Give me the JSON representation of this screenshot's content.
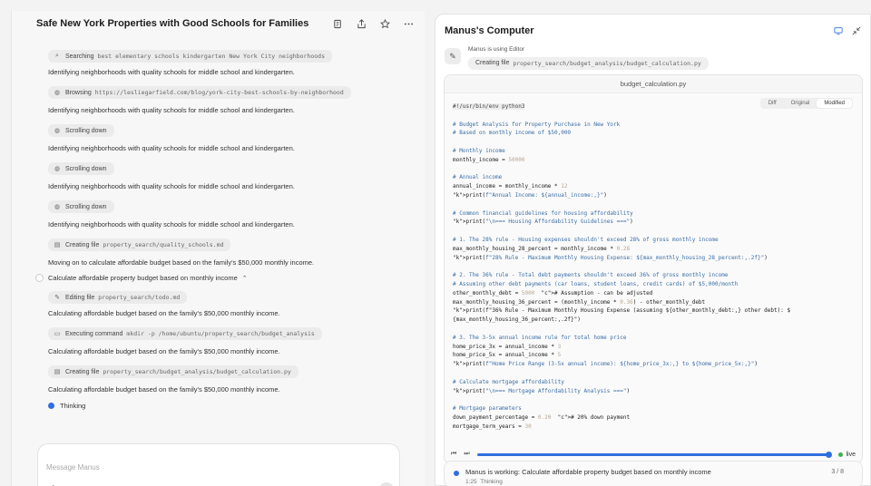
{
  "chat": {
    "title": "Safe New York Properties with Good Schools for Families",
    "composer_placeholder": "Message Manus",
    "steps": [
      {
        "kind": "step",
        "icon": "search-icon",
        "verb": "Searching",
        "arg": "best elementary schools kindergarten New York City neighborhoods"
      },
      {
        "kind": "msg",
        "text": "Identifying neighborhoods with quality schools for middle school and kindergarten."
      },
      {
        "kind": "step",
        "icon": "globe-icon",
        "verb": "Browsing",
        "arg": "https://lesliegarfield.com/blog/york-city-best-schools-by-neighborhood"
      },
      {
        "kind": "msg",
        "text": "Identifying neighborhoods with quality schools for middle school and kindergarten."
      },
      {
        "kind": "step",
        "icon": "globe-icon",
        "verb": "Scrolling down",
        "arg": ""
      },
      {
        "kind": "msg",
        "text": "Identifying neighborhoods with quality schools for middle school and kindergarten."
      },
      {
        "kind": "step",
        "icon": "globe-icon",
        "verb": "Scrolling down",
        "arg": ""
      },
      {
        "kind": "msg",
        "text": "Identifying neighborhoods with quality schools for middle school and kindergarten."
      },
      {
        "kind": "step",
        "icon": "globe-icon",
        "verb": "Scrolling down",
        "arg": ""
      },
      {
        "kind": "msg",
        "text": "Identifying neighborhoods with quality schools for middle school and kindergarten."
      },
      {
        "kind": "step",
        "icon": "file-icon",
        "verb": "Creating file",
        "arg": "property_search/quality_schools.md"
      },
      {
        "kind": "msg",
        "text": "Moving on to calculate affordable budget based on the family's $50,000 monthly income."
      },
      {
        "kind": "task",
        "text": "Calculate affordable property budget based on monthly income"
      },
      {
        "kind": "step",
        "icon": "edit-icon",
        "verb": "Editing file",
        "arg": "property_search/todo.md"
      },
      {
        "kind": "msg",
        "text": "Calculating affordable budget based on the family's $50,000 monthly income."
      },
      {
        "kind": "step",
        "icon": "terminal-icon",
        "verb": "Executing command",
        "arg": "mkdir -p /home/ubuntu/property_search/budget_analysis"
      },
      {
        "kind": "msg",
        "text": "Calculating affordable budget based on the family's $50,000 monthly income."
      },
      {
        "kind": "step",
        "icon": "file-icon",
        "verb": "Creating file",
        "arg": "property_search/budget_analysis/budget_calculation.py"
      },
      {
        "kind": "msg",
        "text": "Calculating affordable budget based on the family's $50,000 monthly income."
      }
    ],
    "thinking_label": "Thinking"
  },
  "computer": {
    "title": "Manus's Computer",
    "using_label": "Manus is using Editor",
    "step_verb": "Creating file",
    "step_arg": "property_search/budget_analysis/budget_calculation.py",
    "filename": "budget_calculation.py",
    "tabs": [
      "Diff",
      "Original",
      "Modified"
    ],
    "active_tab": "Modified",
    "live_label": "live",
    "progress": 0.99,
    "status_text": "Manus is working: Calculate affordable property budget based on monthly income",
    "status_count": "3 / 8",
    "status_time": "1:25",
    "status_sub": "Thinking",
    "code_lines": [
      "#!/usr/bin/env python3",
      "",
      "# Budget Analysis for Property Purchase in New York",
      "# Based on monthly income of $50,000",
      "",
      "# Monthly income",
      "monthly_income = 50000",
      "",
      "# Annual income",
      "annual_income = monthly_income * 12",
      "print(f\"Annual Income: ${annual_income:,}\")",
      "",
      "# Common financial guidelines for housing affordability",
      "print(\"\\n=== Housing Affordability Guidelines ===\")",
      "",
      "# 1. The 28% rule - Housing expenses shouldn't exceed 28% of gross monthly income",
      "max_monthly_housing_28_percent = monthly_income * 0.28",
      "print(f\"28% Rule - Maximum Monthly Housing Expense: ${max_monthly_housing_28_percent:,.2f}\")",
      "",
      "# 2. The 36% rule - Total debt payments shouldn't exceed 36% of gross monthly income",
      "# Assuming other debt payments (car loans, student loans, credit cards) of $5,000/month",
      "other_monthly_debt = 5000  # Assumption - can be adjusted",
      "max_monthly_housing_36_percent = (monthly_income * 0.36) - other_monthly_debt",
      "print(f\"36% Rule - Maximum Monthly Housing Expense (assuming ${other_monthly_debt:,} other debt): $",
      "{max_monthly_housing_36_percent:,.2f}\")",
      "",
      "# 3. The 3-5x annual income rule for total home price",
      "home_price_3x = annual_income * 3",
      "home_price_5x = annual_income * 5",
      "print(f\"Home Price Range (3-5x annual income): ${home_price_3x:,} to ${home_price_5x:,}\")",
      "",
      "# Calculate mortgage affordability",
      "print(\"\\n=== Mortgage Affordability Analysis ===\")",
      "",
      "# Mortgage parameters",
      "down_payment_percentage = 0.20  # 20% down payment",
      "mortgage_term_years = 30"
    ]
  }
}
